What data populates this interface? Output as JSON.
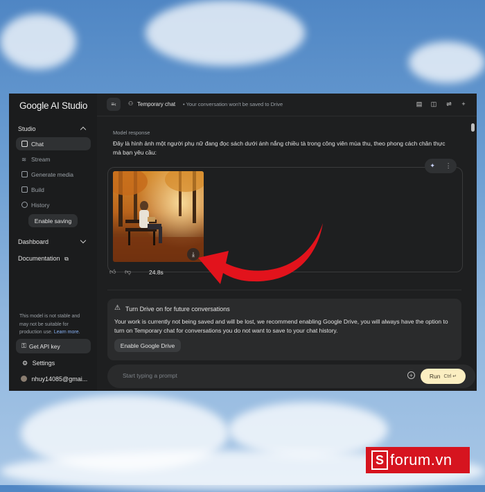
{
  "app": {
    "title": "Google AI Studio"
  },
  "sidebar": {
    "section_studio": "Studio",
    "items": [
      {
        "label": "Chat",
        "active": true
      },
      {
        "label": "Stream",
        "active": false
      },
      {
        "label": "Generate media",
        "active": false
      },
      {
        "label": "Build",
        "active": false
      },
      {
        "label": "History",
        "active": false
      }
    ],
    "enable_saving": "Enable saving",
    "dashboard": "Dashboard",
    "documentation": "Documentation",
    "note": "This model is not stable and may not be suitable for production use.",
    "note_link": "Learn more.",
    "api_key": "Get API key",
    "settings": "Settings",
    "account": "nhuy14085@gmai..."
  },
  "topbar": {
    "title": "Temporary chat",
    "subtitle": "• Your conversation won't be saved to Drive"
  },
  "response": {
    "label": "Model response",
    "text": "Đây là hình ảnh một người phụ nữ đang đọc sách dưới ánh nắng chiều tà trong công viên mùa thu, theo phong cách chân thực mà bạn yêu cầu:",
    "time": "24.8s"
  },
  "drive_card": {
    "title": "Turn Drive on for future conversations",
    "body": "Your work is currently not being saved and will be lost, we recommend enabling Google Drive, you will always have the option to turn on Temporary chat for conversations you do not want to save to your chat history.",
    "button": "Enable Google Drive"
  },
  "prompt": {
    "placeholder": "Start typing a prompt",
    "run": "Run",
    "shortcut": "Ctrl ↵"
  },
  "watermark": {
    "text": "forum.vn",
    "letter": "S"
  },
  "colors": {
    "accent_run": "#fbeec1",
    "arrow": "#e2131c",
    "badge": "#d6141f"
  }
}
